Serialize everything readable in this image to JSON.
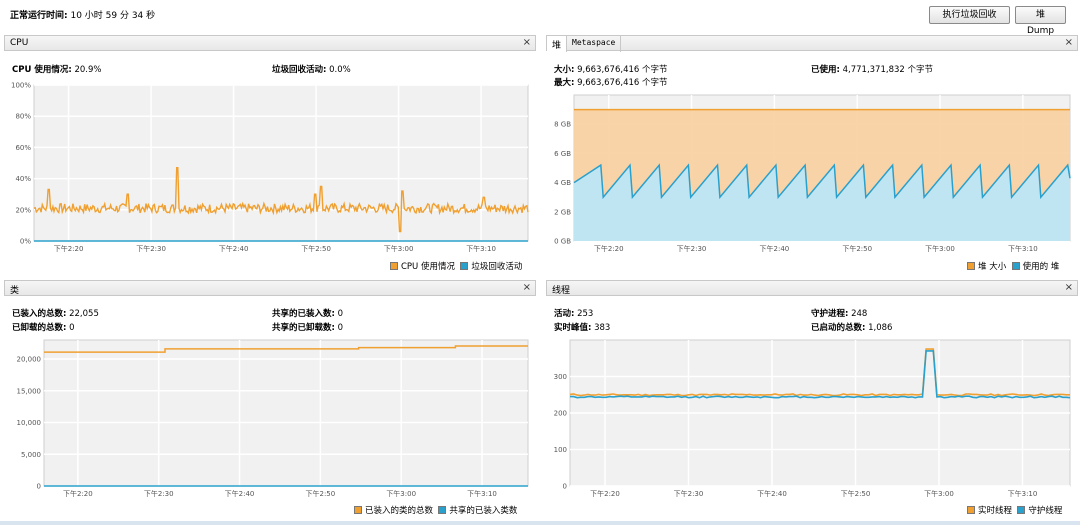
{
  "header": {
    "uptime_label": "正常运行时间:",
    "uptime_value": "10 小时 59 分 34 秒",
    "gc_button": "执行垃圾回收",
    "dump_button": "堆 Dump"
  },
  "colors": {
    "orange": "#f0a030",
    "blue": "#2aa0cc",
    "orange_fill": "#f8cfa0",
    "blue_fill": "#bde6f5"
  },
  "icons": {
    "close": "close-icon"
  },
  "cpu": {
    "title": "CPU",
    "close": "×",
    "usage_label": "CPU 使用情况:",
    "usage_value": "20.9%",
    "gc_label": "垃圾回收活动:",
    "gc_value": "0.0%",
    "legend": [
      "CPU 使用情况",
      "垃圾回收活动"
    ]
  },
  "heap": {
    "tabs": [
      "堆",
      "Metaspace"
    ],
    "close": "×",
    "size_label": "大小:",
    "size_value": "9,663,676,416 个字节",
    "used_label": "已使用:",
    "used_value": "4,771,371,832 个字节",
    "max_label": "最大:",
    "max_value": "9,663,676,416 个字节",
    "legend": [
      "堆 大小",
      "使用的 堆"
    ]
  },
  "classes": {
    "title": "类",
    "close": "×",
    "loaded_label": "已装入的总数:",
    "loaded_value": "22,055",
    "unloaded_label": "已卸载的总数:",
    "unloaded_value": "0",
    "shared_loaded_label": "共享的已装入数:",
    "shared_loaded_value": "0",
    "shared_unloaded_label": "共享的已卸载数:",
    "shared_unloaded_value": "0",
    "legend": [
      "已装入的类的总数",
      "共享的已装入类数"
    ]
  },
  "threads": {
    "title": "线程",
    "close": "×",
    "live_label": "活动:",
    "live_value": "253",
    "peak_label": "实时峰值:",
    "peak_value": "383",
    "daemon_label": "守护进程:",
    "daemon_value": "248",
    "started_label": "已启动的总数:",
    "started_value": "1,086",
    "legend": [
      "实时线程",
      "守护线程"
    ]
  },
  "chart_data": [
    {
      "name": "cpu",
      "type": "line",
      "x": [
        "下午2:20",
        "下午2:30",
        "下午2:40",
        "下午2:50",
        "下午3:00",
        "下午3:10"
      ],
      "ylim": [
        0,
        100
      ],
      "yticks": [
        "0%",
        "20%",
        "40%",
        "60%",
        "80%",
        "100%"
      ],
      "series": [
        {
          "name": "CPU 使用情况",
          "color": "#f0a030",
          "baseline": 21,
          "noise": 3,
          "spikes": [
            [
              0.03,
              33
            ],
            [
              0.19,
              30
            ],
            [
              0.29,
              47
            ],
            [
              0.57,
              30
            ],
            [
              0.58,
              35
            ],
            [
              0.74,
              6
            ],
            [
              0.745,
              32
            ],
            [
              0.91,
              28
            ]
          ]
        },
        {
          "name": "垃圾回收活动",
          "color": "#2aa0cc",
          "values": [
            0,
            0,
            0,
            0,
            0,
            0
          ]
        }
      ]
    },
    {
      "name": "heap",
      "type": "area",
      "x": [
        "下午2:20",
        "下午2:30",
        "下午2:40",
        "下午2:50",
        "下午3:00",
        "下午3:10"
      ],
      "ylim": [
        0,
        10
      ],
      "yticks": [
        "0 GB",
        "2 GB",
        "4 GB",
        "6 GB",
        "8 GB"
      ],
      "series": [
        {
          "name": "堆 大小",
          "color": "#f0a030",
          "values": [
            9,
            9,
            9,
            9,
            9,
            9
          ]
        },
        {
          "name": "使用的 堆",
          "color": "#2aa0cc",
          "sawtooth": {
            "low": 3.0,
            "high": 5.2,
            "cycles": 17
          }
        }
      ]
    },
    {
      "name": "classes",
      "type": "line",
      "x": [
        "下午2:20",
        "下午2:30",
        "下午2:40",
        "下午2:50",
        "下午3:00",
        "下午3:10"
      ],
      "ylim": [
        0,
        23000
      ],
      "yticks": [
        "0",
        "5,000",
        "10,000",
        "15,000",
        "20,000"
      ],
      "series": [
        {
          "name": "已装入的类的总数",
          "color": "#f0a030",
          "steps": [
            [
              0,
              21100
            ],
            [
              0.25,
              21600
            ],
            [
              0.65,
              21800
            ],
            [
              0.85,
              22055
            ],
            [
              1,
              22055
            ]
          ]
        },
        {
          "name": "共享的已装入类数",
          "color": "#2aa0cc",
          "values": [
            0,
            0,
            0,
            0,
            0,
            0
          ]
        }
      ]
    },
    {
      "name": "threads",
      "type": "line",
      "x": [
        "下午2:20",
        "下午2:30",
        "下午2:40",
        "下午2:50",
        "下午3:00",
        "下午3:10"
      ],
      "ylim": [
        0,
        400
      ],
      "yticks": [
        "300",
        "200",
        "100",
        "0"
      ],
      "series": [
        {
          "name": "实时线程",
          "color": "#f0a030",
          "baseline": 250,
          "peak": [
            0.72,
            375
          ]
        },
        {
          "name": "守护线程",
          "color": "#2aa0cc",
          "baseline": 244,
          "peak": [
            0.72,
            370
          ]
        }
      ]
    }
  ]
}
